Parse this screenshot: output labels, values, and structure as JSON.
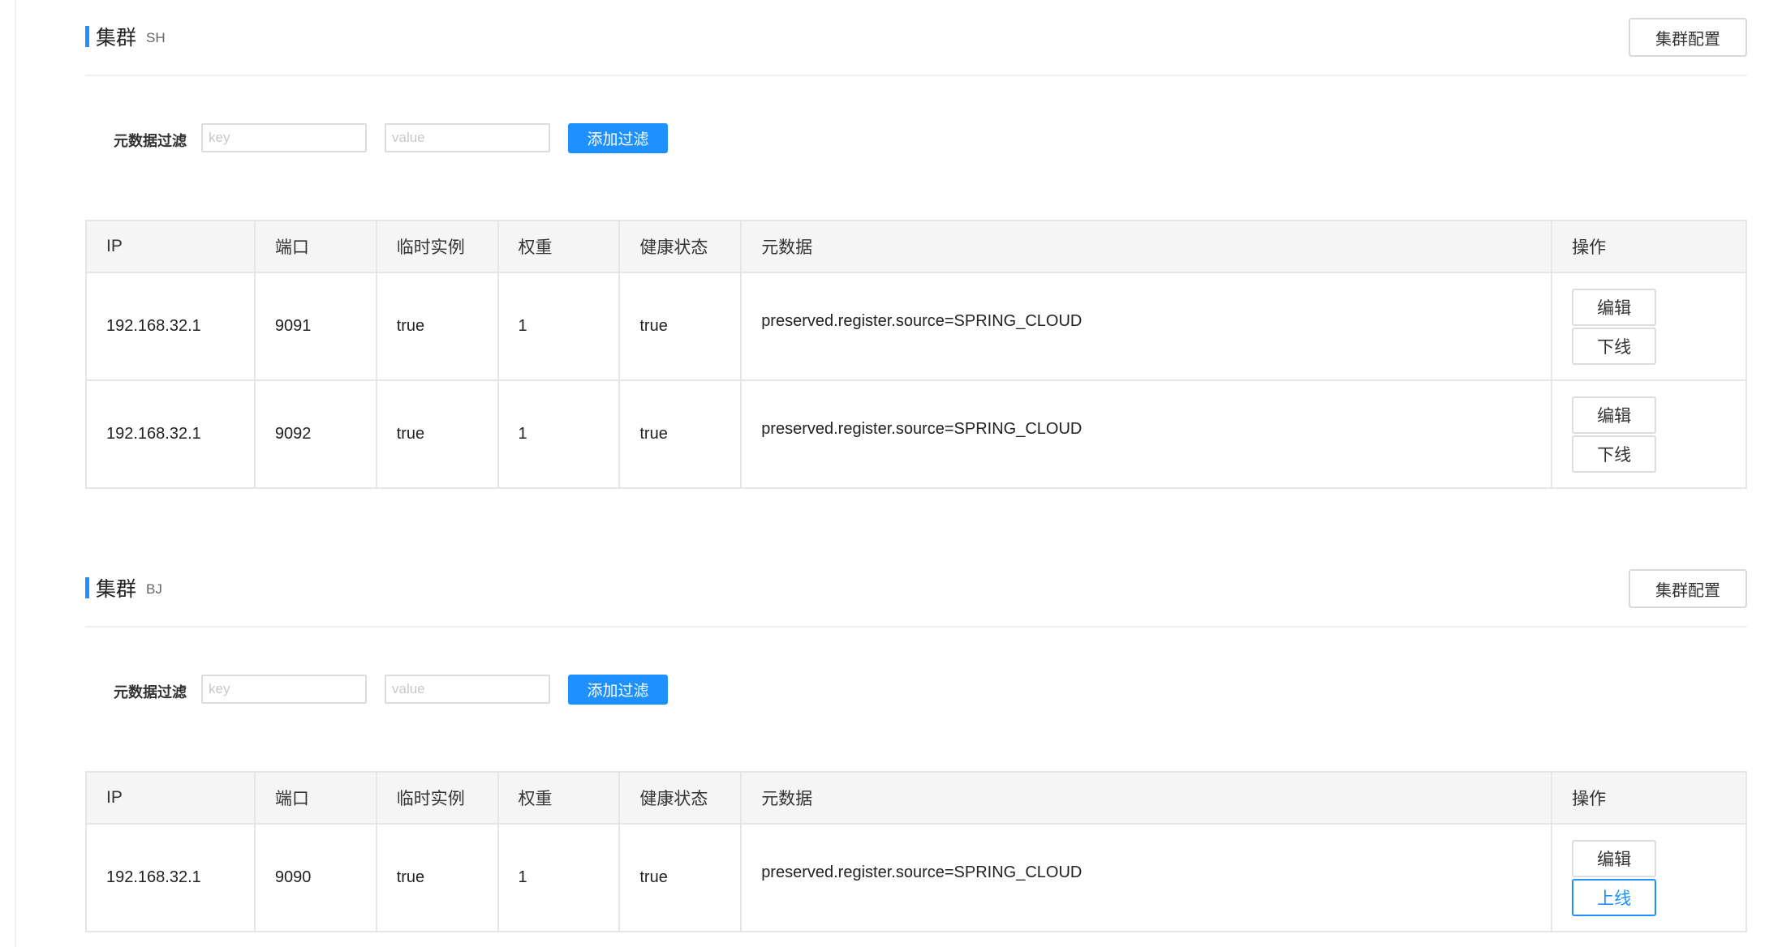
{
  "clusters": [
    {
      "title": "集群",
      "name": "SH",
      "config_label": "集群配置",
      "filter": {
        "label": "元数据过滤",
        "key_placeholder": "key",
        "value_placeholder": "value",
        "add_label": "添加过滤"
      },
      "columns": [
        "IP",
        "端口",
        "临时实例",
        "权重",
        "健康状态",
        "元数据",
        "操作"
      ],
      "rows": [
        {
          "ip": "192.168.32.1",
          "port": "9091",
          "ephemeral": "true",
          "weight": "1",
          "healthy": "true",
          "metadata": "preserved.register.source=SPRING_CLOUD",
          "edit_label": "编辑",
          "toggle_label": "下线"
        },
        {
          "ip": "192.168.32.1",
          "port": "9092",
          "ephemeral": "true",
          "weight": "1",
          "healthy": "true",
          "metadata": "preserved.register.source=SPRING_CLOUD",
          "edit_label": "编辑",
          "toggle_label": "下线"
        }
      ]
    },
    {
      "title": "集群",
      "name": "BJ",
      "config_label": "集群配置",
      "filter": {
        "label": "元数据过滤",
        "key_placeholder": "key",
        "value_placeholder": "value",
        "add_label": "添加过滤"
      },
      "columns": [
        "IP",
        "端口",
        "临时实例",
        "权重",
        "健康状态",
        "元数据",
        "操作"
      ],
      "rows": [
        {
          "ip": "192.168.32.1",
          "port": "9090",
          "ephemeral": "true",
          "weight": "1",
          "healthy": "true",
          "metadata": "preserved.register.source=SPRING_CLOUD",
          "edit_label": "编辑",
          "toggle_label": "上线"
        }
      ]
    }
  ],
  "colors": {
    "accent": "#1e90ff",
    "border": "#e6e6e6",
    "header_bg": "#f5f5f5"
  }
}
